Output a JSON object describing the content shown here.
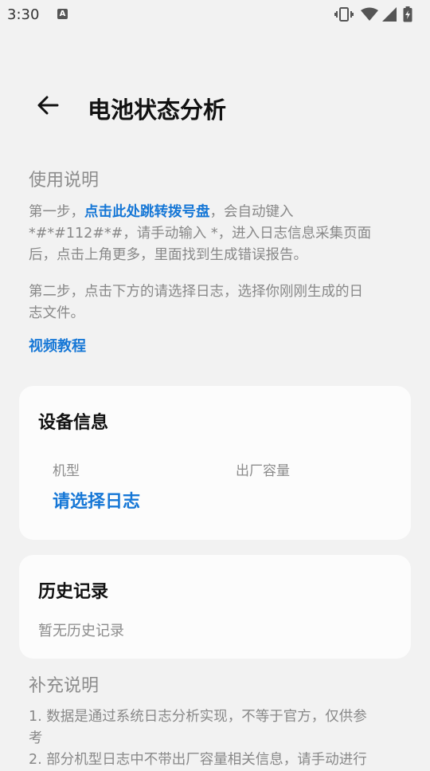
{
  "status_bar": {
    "time": "3:30",
    "notification_icon": "A",
    "icons": [
      "vibrate-icon",
      "wifi-icon",
      "signal-icon",
      "battery-charging-icon"
    ]
  },
  "header": {
    "back_icon": "arrow-left-icon",
    "title": "电池状态分析"
  },
  "usage": {
    "title": "使用说明",
    "step1_prefix": "第一步，",
    "step1_link": "点击此处跳转拨号盘",
    "step1_line1_suffix": "，会自动键入",
    "step1_line2": "*#*#112#*#，请手动输入 *，进入日志信息采集页面",
    "step1_line3": "后，点击上角更多，里面找到生成错误报告。",
    "step2_line1": "第二步，点击下方的请选择日志，选择你刚刚生成的日",
    "step2_line2": "志文件。",
    "video_link": "视频教程"
  },
  "device_info": {
    "title": "设备信息",
    "model_label": "机型",
    "capacity_label": "出厂容量",
    "select_log": "请选择日志"
  },
  "history": {
    "title": "历史记录",
    "empty_text": "暂无历史记录"
  },
  "supplement": {
    "title": "补充说明",
    "note1_line1": "1. 数据是通过系统日志分析实现，不等于官方，仅供参",
    "note1_line2": "考",
    "note2_line1": "2. 部分机型日志中不带出厂容量相关信息，请手动进行"
  },
  "colors": {
    "background": "#f2f2f2",
    "card": "#fcfcfc",
    "accent": "#1677d6",
    "muted_text": "#8c8c8c"
  }
}
